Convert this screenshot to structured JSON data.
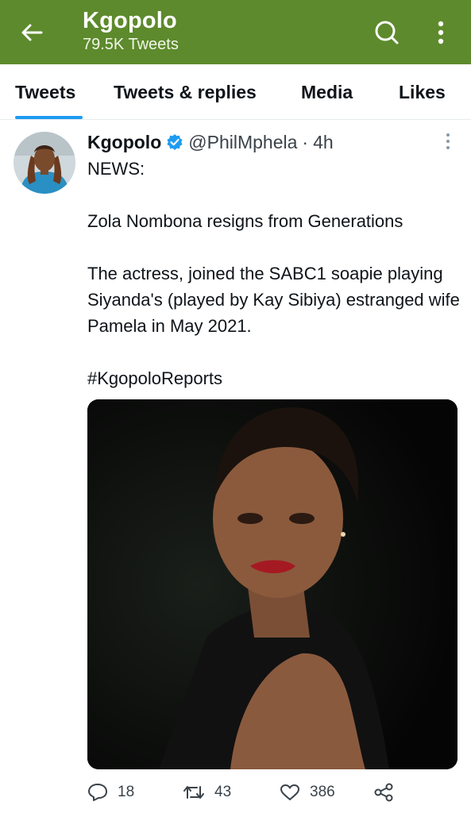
{
  "header": {
    "title": "Kgopolo",
    "subtitle": "79.5K Tweets",
    "background": "#5d8a2c",
    "icons": [
      "back-arrow-icon",
      "search-icon",
      "more-vertical-icon"
    ]
  },
  "tabs": [
    {
      "label": "Tweets",
      "active": true
    },
    {
      "label": "Tweets & replies",
      "active": false
    },
    {
      "label": "Media",
      "active": false
    },
    {
      "label": "Likes",
      "active": false
    }
  ],
  "tweet": {
    "author": "Kgopolo",
    "handle": "@PhilMphela",
    "separator": "·",
    "time": "4h",
    "verified": true,
    "lines": {
      "l1": "NEWS:",
      "l2": "Zola Nombona resigns from Generations",
      "l3": "The actress, joined the SABC1 soapie playing Siyanda's (played by Kay Sibiya) estranged wife Pamela in May 2021.",
      "l4": "#KgopoloReports"
    },
    "media_description": "portrait-photo",
    "stats": {
      "replies": "18",
      "retweets": "43",
      "likes": "386"
    }
  },
  "colors": {
    "accent": "#1d9bf0",
    "verified": "#1d9bf0",
    "header": "#5d8a2c"
  }
}
